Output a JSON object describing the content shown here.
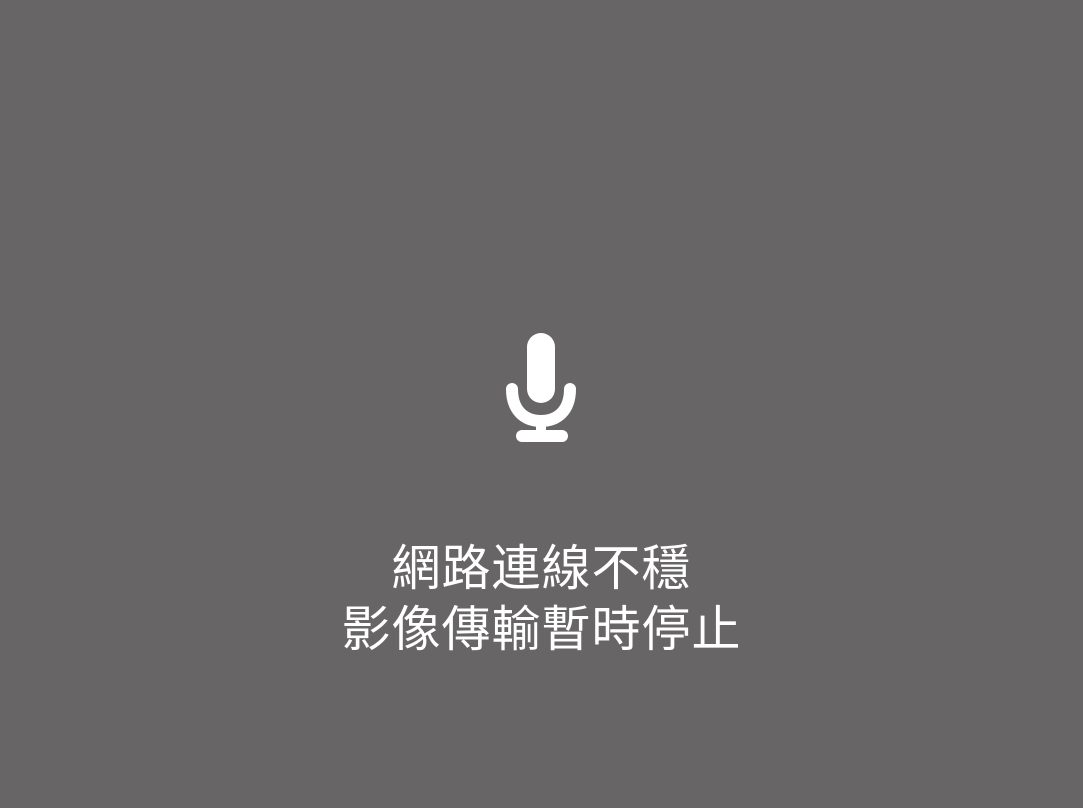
{
  "colors": {
    "background": "#676566",
    "foreground": "#ffffff"
  },
  "icon": {
    "name": "microphone-icon"
  },
  "message": {
    "line1": "網路連線不穩",
    "line2": "影像傳輸暫時停止"
  }
}
